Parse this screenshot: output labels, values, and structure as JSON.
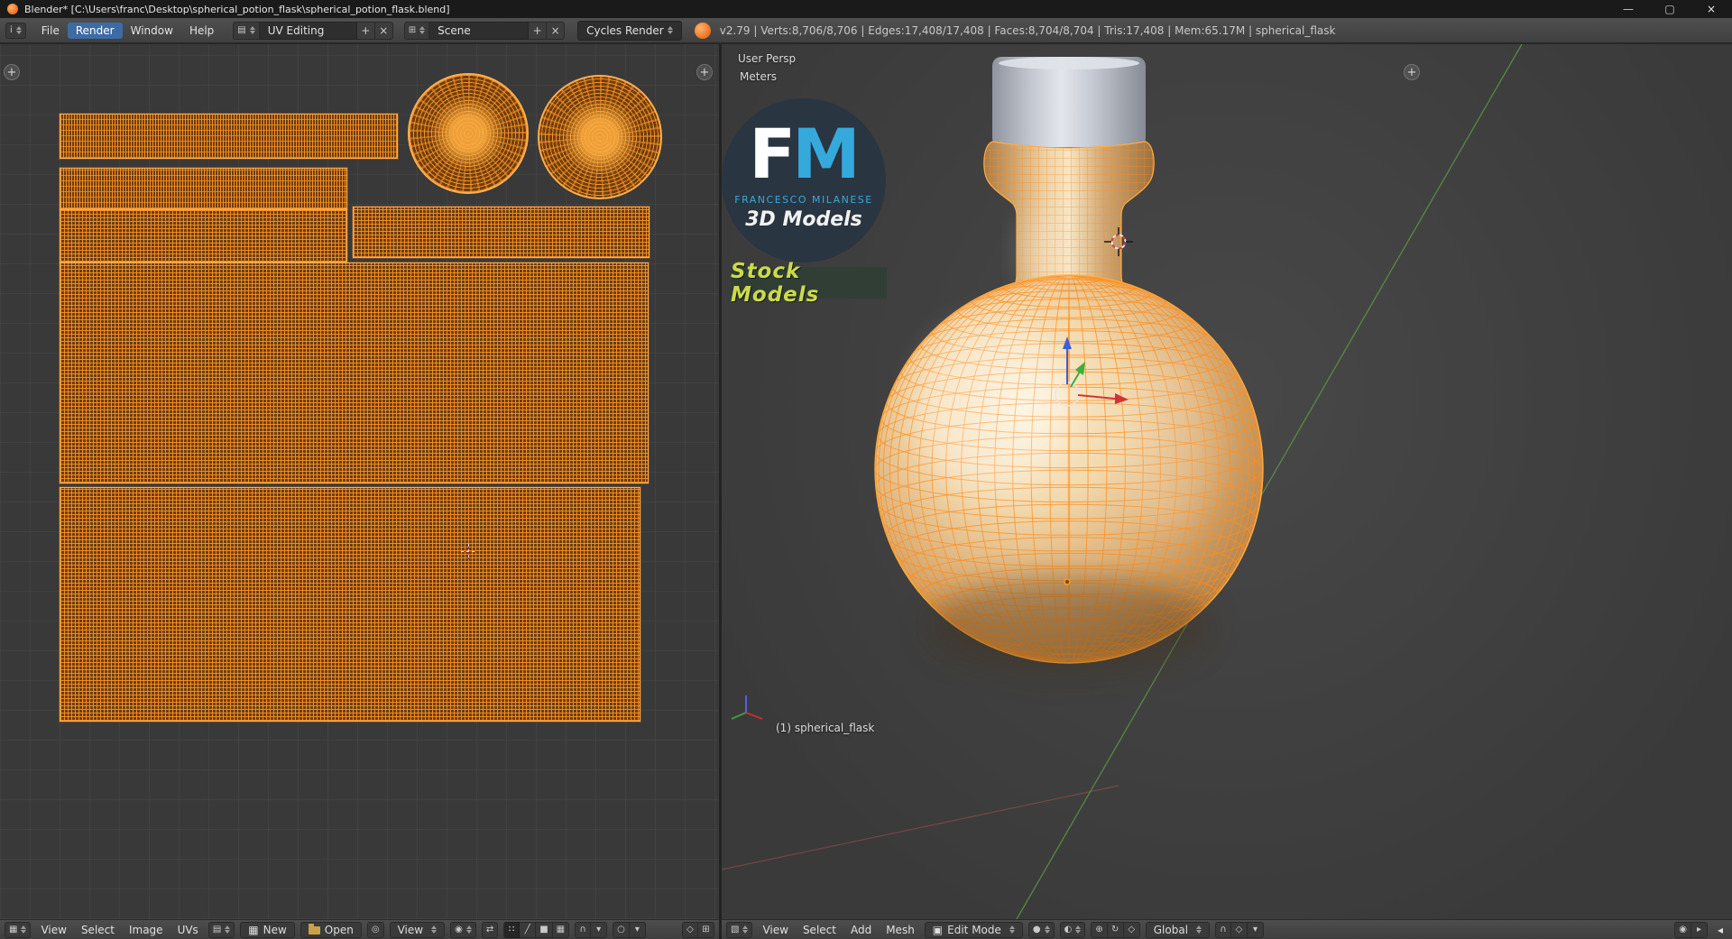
{
  "window": {
    "title": "Blender* [C:\\Users\\franc\\Desktop\\spherical_potion_flask\\spherical_potion_flask.blend]",
    "minimize": "—",
    "maximize": "▢",
    "close": "×"
  },
  "topbar": {
    "menus": [
      {
        "label": "File"
      },
      {
        "label": "Render"
      },
      {
        "label": "Window"
      },
      {
        "label": "Help"
      }
    ],
    "layout_value": "UV Editing",
    "scene_value": "Scene",
    "engine_value": "Cycles Render",
    "add_label": "+",
    "unlink_label": "×",
    "stats": "v2.79 | Verts:8,706/8,706 | Edges:17,408/17,408 | Faces:8,704/8,704 | Tris:17,408 | Mem:65.17M | spherical_flask"
  },
  "viewport": {
    "view_name": "User Persp",
    "unit_label": "Meters",
    "object_info": "(1) spherical_flask",
    "watermark": {
      "f": "F",
      "m": "M",
      "subtitle": "FRANCESCO MILANESE",
      "tagline": "3D Models",
      "badge": "Stock Models"
    }
  },
  "uv_header": {
    "menus": [
      "View",
      "Select",
      "Image",
      "UVs"
    ],
    "new_label": "New",
    "open_label": "Open",
    "mode_value": "View"
  },
  "v3d_header": {
    "menus": [
      "View",
      "Select",
      "Add",
      "Mesh"
    ],
    "mode_value": "Edit Mode",
    "orientation_value": "Global"
  },
  "icons": {
    "info_editor": "i",
    "screen_layout": "▤",
    "scene_datablock": "⊞",
    "image_editor": "▦",
    "view3d_editor": "▧",
    "image_browse": "▤",
    "image_new": "▦",
    "pin": "◎",
    "pivot": "◉",
    "sync_select": "⇄",
    "select_vertex": "∷",
    "select_edge": "╱",
    "select_face": "■",
    "select_island": "▦",
    "snap_magnet": "∩",
    "dropdown_arrow": "▾",
    "proportional": "○",
    "mode_cube": "▣",
    "shading_sphere": "●",
    "matcap_sphere": "◐",
    "manip_translate": "⊕",
    "manip_rotate": "↻",
    "manip_scale": "◇",
    "snap_element": "◇",
    "render_opengl": "◉",
    "render_anim": "▸",
    "corner_plus": "+",
    "header_arrow": "◂"
  },
  "colors": {
    "uv_orange": "#ff8c1a",
    "selection_highlight": "#3d6ca5",
    "logo_blue": "#36a9dc",
    "badge_yellow": "#ccda4b",
    "blender_orange": "#ee7a2d",
    "axis_green": "#5d9b43",
    "axis_red": "#b05050",
    "axis_blue": "#3a6fd8"
  }
}
